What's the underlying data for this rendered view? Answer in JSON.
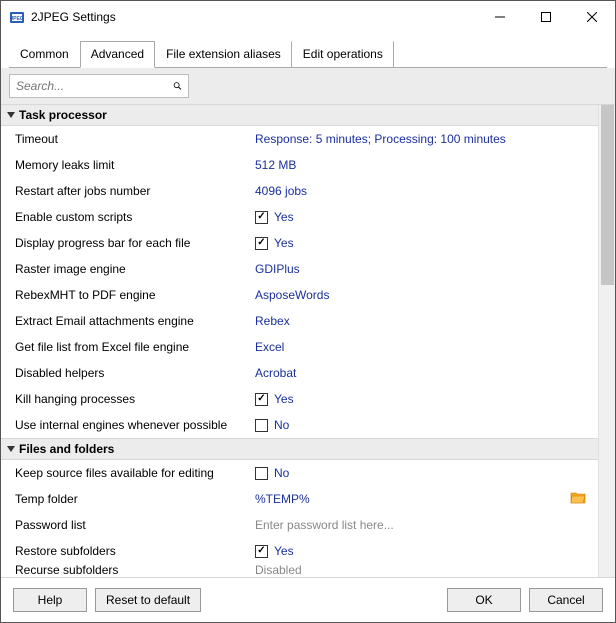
{
  "window": {
    "title": "2JPEG Settings"
  },
  "tabs": {
    "common": "Common",
    "advanced": "Advanced",
    "file_ext": "File extension aliases",
    "edit_ops": "Edit operations",
    "active": "advanced"
  },
  "search": {
    "placeholder": "Search..."
  },
  "sections": {
    "task_processor": {
      "title": "Task processor",
      "rows": {
        "timeout": {
          "label": "Timeout",
          "value": "Response: 5 minutes; Processing: 100 minutes"
        },
        "mem_leaks": {
          "label": "Memory leaks limit",
          "value": "512 MB"
        },
        "restart_jobs": {
          "label": "Restart after jobs number",
          "value": "4096 jobs"
        },
        "custom_scripts": {
          "label": "Enable custom scripts",
          "value": "Yes",
          "checked": true
        },
        "progress_bar": {
          "label": "Display progress bar for each file",
          "value": "Yes",
          "checked": true
        },
        "raster_engine": {
          "label": "Raster image engine",
          "value": "GDIPlus"
        },
        "rebexmht": {
          "label": "RebexMHT to PDF engine",
          "value": "AsposeWords"
        },
        "email_attach": {
          "label": "Extract Email attachments engine",
          "value": "Rebex"
        },
        "excel_list": {
          "label": "Get file list from Excel file engine",
          "value": "Excel"
        },
        "disabled_helpers": {
          "label": "Disabled helpers",
          "value": "Acrobat"
        },
        "kill_hanging": {
          "label": "Kill hanging processes",
          "value": "Yes",
          "checked": true
        },
        "internal_engines": {
          "label": "Use internal engines whenever possible",
          "value": "No",
          "checked": false
        }
      }
    },
    "files_folders": {
      "title": "Files and folders",
      "rows": {
        "keep_source": {
          "label": "Keep source files available for editing",
          "value": "No",
          "checked": false
        },
        "temp_folder": {
          "label": "Temp folder",
          "value": "%TEMP%"
        },
        "password_list": {
          "label": "Password list",
          "placeholder": "Enter password list here..."
        },
        "restore_sub": {
          "label": "Restore subfolders",
          "value": "Yes",
          "checked": true
        },
        "recurse_sub": {
          "label": "Recurse subfolders",
          "value": "Disabled"
        }
      }
    }
  },
  "footer": {
    "help": "Help",
    "reset": "Reset to default",
    "ok": "OK",
    "cancel": "Cancel"
  }
}
